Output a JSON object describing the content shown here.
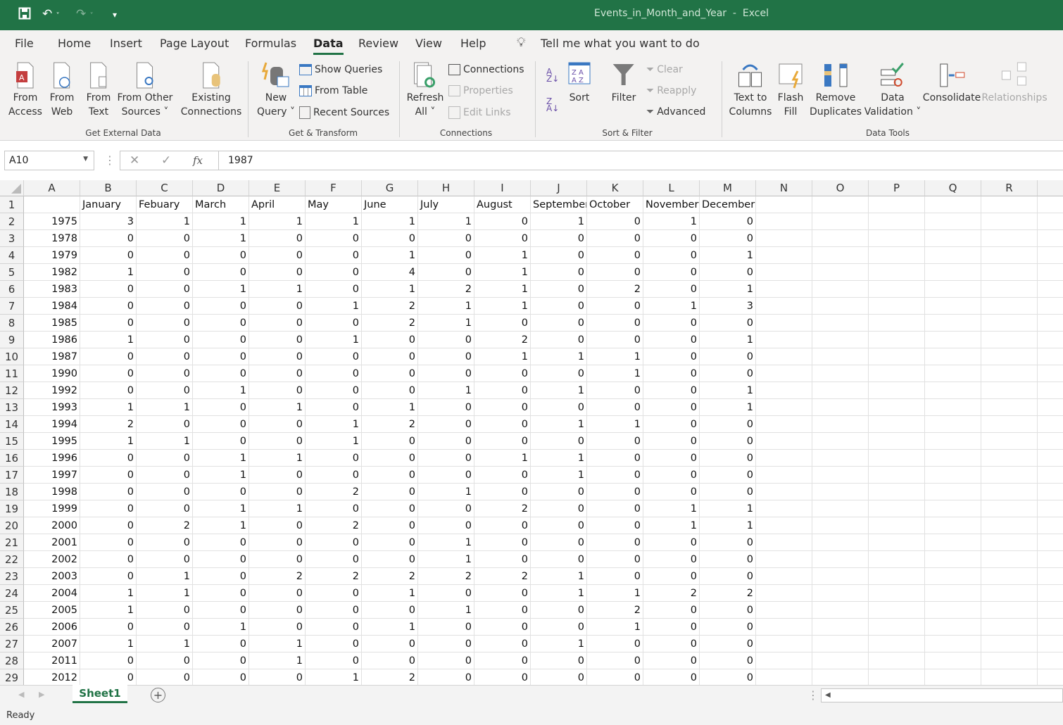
{
  "window": {
    "title": "Events_in_Month_and_Year  -  Excel",
    "accent": "#217346"
  },
  "quick_access": {
    "save": "save-icon",
    "undo": "undo-icon",
    "redo": "redo-icon",
    "customize": "customize-icon"
  },
  "menu_tabs": [
    "File",
    "Home",
    "Insert",
    "Page Layout",
    "Formulas",
    "Data",
    "Review",
    "View",
    "Help"
  ],
  "active_tab": "Data",
  "tell_me": "Tell me what you want to do",
  "ribbon": {
    "get_external_data": {
      "label": "Get External Data",
      "buttons": [
        [
          "From",
          "Access"
        ],
        [
          "From",
          "Web"
        ],
        [
          "From",
          "Text"
        ],
        [
          "From Other",
          "Sources ˅"
        ],
        [
          "Existing",
          "Connections"
        ]
      ]
    },
    "get_transform": {
      "label": "Get & Transform",
      "new_query": [
        "New",
        "Query ˅"
      ],
      "show_queries": "Show Queries",
      "from_table": "From Table",
      "recent_sources": "Recent Sources"
    },
    "connections": {
      "label": "Connections",
      "refresh_all": [
        "Refresh",
        "All ˅"
      ],
      "connections": "Connections",
      "properties": "Properties",
      "edit_links": "Edit Links"
    },
    "sort_filter": {
      "label": "Sort & Filter",
      "sort": "Sort",
      "filter": "Filter",
      "clear": "Clear",
      "reapply": "Reapply",
      "advanced": "Advanced"
    },
    "data_tools": {
      "label": "Data Tools",
      "text_to_columns": [
        "Text to",
        "Columns"
      ],
      "flash_fill": [
        "Flash",
        "Fill"
      ],
      "remove_duplicates": [
        "Remove",
        "Duplicates"
      ],
      "data_validation": [
        "Data",
        "Validation ˅"
      ],
      "consolidate": "Consolidate",
      "relationships": "Relationships"
    }
  },
  "formula_bar": {
    "name_box": "A10",
    "fx": "fx",
    "value": "1987"
  },
  "columns": [
    "A",
    "B",
    "C",
    "D",
    "E",
    "F",
    "G",
    "H",
    "I",
    "J",
    "K",
    "L",
    "M",
    "N",
    "O",
    "P",
    "Q",
    "R"
  ],
  "header_row": [
    "",
    "January",
    "Febuary",
    "March",
    "April",
    "May",
    "June",
    "July",
    "August",
    "September",
    "October",
    "November",
    "December"
  ],
  "rows": [
    [
      "1975",
      3,
      1,
      1,
      1,
      1,
      1,
      1,
      0,
      1,
      0,
      1,
      0
    ],
    [
      "1978",
      0,
      0,
      1,
      0,
      0,
      0,
      0,
      0,
      0,
      0,
      0,
      0
    ],
    [
      "1979",
      0,
      0,
      0,
      0,
      0,
      1,
      0,
      1,
      0,
      0,
      0,
      1
    ],
    [
      "1982",
      1,
      0,
      0,
      0,
      0,
      4,
      0,
      1,
      0,
      0,
      0,
      0
    ],
    [
      "1983",
      0,
      0,
      1,
      1,
      0,
      1,
      2,
      1,
      0,
      2,
      0,
      1
    ],
    [
      "1984",
      0,
      0,
      0,
      0,
      1,
      2,
      1,
      1,
      0,
      0,
      1,
      3
    ],
    [
      "1985",
      0,
      0,
      0,
      0,
      0,
      2,
      1,
      0,
      0,
      0,
      0,
      0
    ],
    [
      "1986",
      1,
      0,
      0,
      0,
      1,
      0,
      0,
      2,
      0,
      0,
      0,
      1
    ],
    [
      "1987",
      0,
      0,
      0,
      0,
      0,
      0,
      0,
      1,
      1,
      1,
      0,
      0
    ],
    [
      "1990",
      0,
      0,
      0,
      0,
      0,
      0,
      0,
      0,
      0,
      1,
      0,
      0
    ],
    [
      "1992",
      0,
      0,
      1,
      0,
      0,
      0,
      1,
      0,
      1,
      0,
      0,
      1
    ],
    [
      "1993",
      1,
      1,
      0,
      1,
      0,
      1,
      0,
      0,
      0,
      0,
      0,
      1
    ],
    [
      "1994",
      2,
      0,
      0,
      0,
      1,
      2,
      0,
      0,
      1,
      1,
      0,
      0
    ],
    [
      "1995",
      1,
      1,
      0,
      0,
      1,
      0,
      0,
      0,
      0,
      0,
      0,
      0
    ],
    [
      "1996",
      0,
      0,
      1,
      1,
      0,
      0,
      0,
      1,
      1,
      0,
      0,
      0
    ],
    [
      "1997",
      0,
      0,
      1,
      0,
      0,
      0,
      0,
      0,
      1,
      0,
      0,
      0
    ],
    [
      "1998",
      0,
      0,
      0,
      0,
      2,
      0,
      1,
      0,
      0,
      0,
      0,
      0
    ],
    [
      "1999",
      0,
      0,
      1,
      1,
      0,
      0,
      0,
      2,
      0,
      0,
      1,
      1
    ],
    [
      "2000",
      0,
      2,
      1,
      0,
      2,
      0,
      0,
      0,
      0,
      0,
      1,
      1
    ],
    [
      "2001",
      0,
      0,
      0,
      0,
      0,
      0,
      1,
      0,
      0,
      0,
      0,
      0
    ],
    [
      "2002",
      0,
      0,
      0,
      0,
      0,
      0,
      1,
      0,
      0,
      0,
      0,
      0
    ],
    [
      "2003",
      0,
      1,
      0,
      2,
      2,
      2,
      2,
      2,
      1,
      0,
      0,
      0
    ],
    [
      "2004",
      1,
      1,
      0,
      0,
      0,
      1,
      0,
      0,
      1,
      1,
      2,
      2
    ],
    [
      "2005",
      1,
      0,
      0,
      0,
      0,
      0,
      1,
      0,
      0,
      2,
      0,
      0
    ],
    [
      "2006",
      0,
      0,
      1,
      0,
      0,
      1,
      0,
      0,
      0,
      1,
      0,
      0
    ],
    [
      "2007",
      1,
      1,
      0,
      1,
      0,
      0,
      0,
      0,
      1,
      0,
      0,
      0
    ],
    [
      "2011",
      0,
      0,
      0,
      1,
      0,
      0,
      0,
      0,
      0,
      0,
      0,
      0
    ],
    [
      "2012",
      0,
      0,
      0,
      0,
      1,
      2,
      0,
      0,
      0,
      0,
      0,
      0
    ]
  ],
  "sheet_tabs": [
    "Sheet1"
  ],
  "status": "Ready"
}
